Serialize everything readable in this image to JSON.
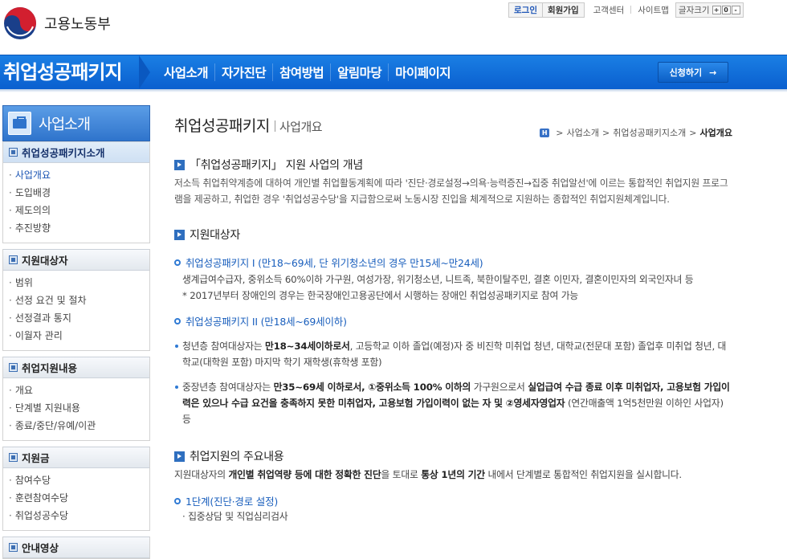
{
  "header": {
    "logo_text": "고용노동부",
    "util": {
      "login": "로그인",
      "join": "회원가입",
      "help": "고객센터",
      "sitemap": "사이트맵",
      "font_size_label": "글자크기",
      "font_plus": "+",
      "font_reset": "0",
      "font_minus": "-"
    }
  },
  "gnb": {
    "brand": "취업성공패키지",
    "menu": [
      "사업소개",
      "자가진단",
      "참여방법",
      "알림마당",
      "마이페이지"
    ],
    "apply_label": "신청하기",
    "apply_arrow": "→"
  },
  "lnb": {
    "title": "사업소개",
    "groups": [
      {
        "head": "취업성공패키지소개",
        "items": [
          "사업개요",
          "도입배경",
          "제도의의",
          "추진방향"
        ]
      },
      {
        "head": "지원대상자",
        "items": [
          "범위",
          "선정 요건 및 절차",
          "선정결과 통지",
          "이월자 관리"
        ]
      },
      {
        "head": "취업지원내용",
        "items": [
          "개요",
          "단계별 지원내용",
          "종료/중단/유예/이관"
        ]
      },
      {
        "head": "지원금",
        "items": [
          "참여수당",
          "훈련참여수당",
          "취업성공수당"
        ]
      },
      {
        "head": "안내영상",
        "items": []
      }
    ]
  },
  "content": {
    "title": "취업성공패키지",
    "subtitle": "사업개요",
    "breadcrumb": {
      "home": "H",
      "items": [
        "사업소개",
        "취업성공패키지소개"
      ],
      "current": "사업개요"
    },
    "sec1": {
      "title": "「취업성공패키지」 지원 사업의 개념",
      "body": "저소득 취업취약계층에 대하여 개인별 취업활동계획에 따라 '진단·경로설정→의욕·능력증진→집중 취업알선'에 이르는 통합적인 취업지원 프로그램을 제공하고, 취업한 경우 '취업성공수당'을 지급함으로써 노동시장 진입을 체계적으로 지원하는 종합적인 취업지원체계입니다."
    },
    "sec2": {
      "title": "지원대상자",
      "pkg1_title": "취업성공패키지 I (만18~69세, 단 위기청소년의 경우 만15세~만24세)",
      "pkg1_body": "생계급여수급자, 중위소득 60%이하 가구원, 여성가장, 위기청소년, 니트족, 북한이탈주민, 결혼 이민자, 결혼이민자의 외국인자녀 등",
      "pkg1_note": "* 2017년부터 장애인의 경우는 한국장애인고용공단에서 시행하는 장애인 취업성공패키지로 참여 가능",
      "pkg2_title": "취업성공패키지 II (만18세~69세이하)",
      "b1_a": "청년층 참여대상자는 ",
      "b1_b": "만18~34세이하로서",
      "b1_c": ", 고등학교 이하 졸업(예정)자 중 비진학 미취업 청년, 대학교(전문대 포함) 졸업후 미취업 청년, 대학교(대학원 포함) 마지막 학기 재학생(휴학생 포함)",
      "b2_a": "중장년층 참여대상자는 ",
      "b2_b": "만35~69세 이하로서, ①중위소득 100% 이하의",
      "b2_c": " 가구원으로서 ",
      "b2_d": "실업급여 수급 종료 이후 미취업자, 고용보험 가입이력은 있으나 수급 요건을 충족하지 못한 미취업자, 고용보험 가입이력이 없는 자 및 ②영세자영업자",
      "b2_e": " (연간매출액 1억5천만원 이하인 사업자) 등"
    },
    "sec3": {
      "title": "취업지원의 주요내용",
      "body_a": "지원대상자의 ",
      "body_b": "개인별 취업역량 등에 대한 정확한 진단",
      "body_c": "을 토대로 ",
      "body_d": "통상 1년의 기간",
      "body_e": " 내에서 단계별로 통합적인 취업지원을 실시합니다.",
      "step1": "1단계(진단·경로 설정)",
      "step1_body": "· 집중상담 및 직업심리검사"
    }
  }
}
